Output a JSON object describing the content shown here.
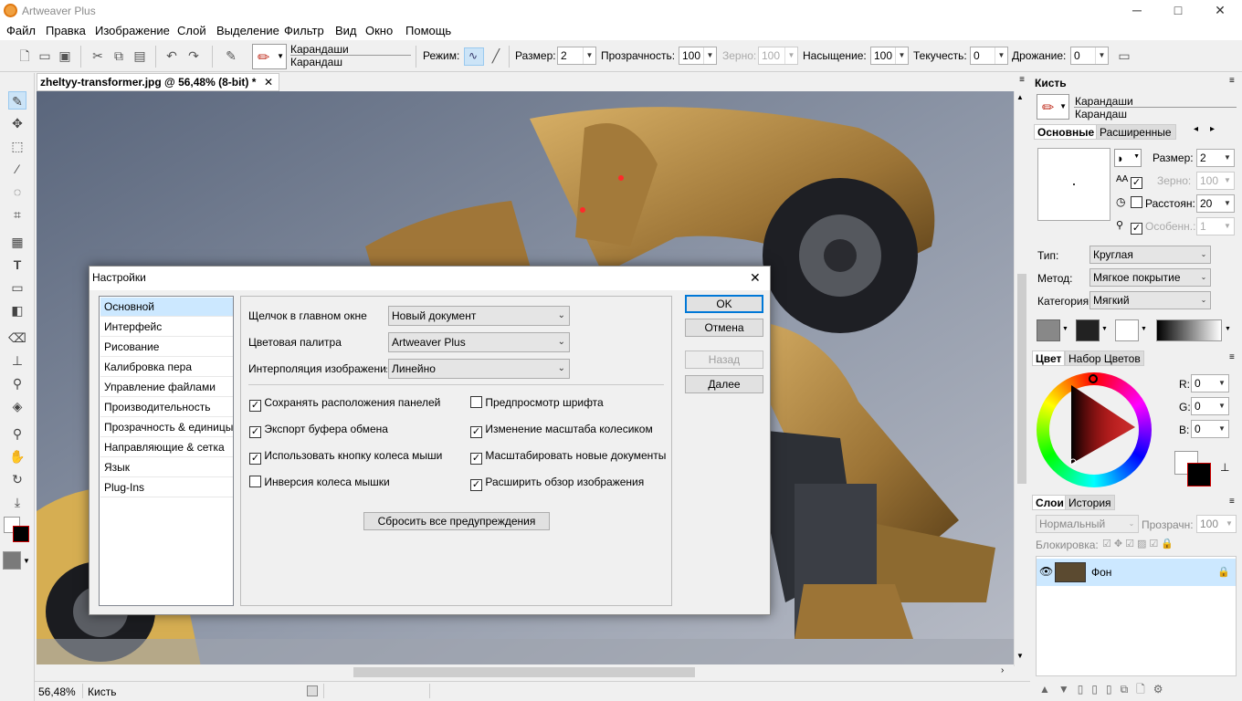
{
  "app": {
    "title": "Artweaver Plus",
    "min": "─",
    "max": "□",
    "close": "✕"
  },
  "menu": [
    "Файл",
    "Правка",
    "Изображение",
    "Слой",
    "Выделение",
    "Фильтр",
    "Вид",
    "Окно",
    "Помощь"
  ],
  "toolbar": {
    "brush_category": "Карандаши",
    "brush_name": "Карандаш",
    "mode_label": "Режим:",
    "size_label": "Размер:",
    "size_value": "2",
    "opacity_label": "Прозрачность:",
    "opacity_value": "100",
    "grain_label": "Зерно:",
    "grain_value": "100",
    "saturation_label": "Насыщение:",
    "saturation_value": "100",
    "flow_label": "Текучесть:",
    "flow_value": "0",
    "jitter_label": "Дрожание:",
    "jitter_value": "0"
  },
  "document": {
    "tab_title": "zheltyy-transformer.jpg @ 56,48% (8-bit) *",
    "close": "✕"
  },
  "status": {
    "zoom": "56,48%",
    "tool": "Кисть"
  },
  "brush_panel": {
    "title": "Кисть",
    "category": "Карандаши",
    "name": "Карандаш",
    "tabs": [
      "Основные",
      "Расширенные"
    ],
    "size_label": "Размер:",
    "size_value": "2",
    "grain_label": "Зерно:",
    "grain_value": "100",
    "spacing_label": "Расстоян:",
    "spacing_value": "20",
    "feature_label": "Особенн.:",
    "feature_value": "1",
    "type_label": "Тип:",
    "type_value": "Круглая",
    "method_label": "Метод:",
    "method_value": "Мягкое покрытие",
    "category_label": "Категория:",
    "category_value": "Мягкий"
  },
  "color_panel": {
    "tabs": [
      "Цвет",
      "Набор Цветов"
    ],
    "r_label": "R:",
    "r_value": "0",
    "g_label": "G:",
    "g_value": "0",
    "b_label": "B:",
    "b_value": "0",
    "foreground": "#000000",
    "background": "#ffffff"
  },
  "layers_panel": {
    "tabs": [
      "Слои",
      "История"
    ],
    "blend_mode": "Нормальный",
    "opacity_label": "Прозрачн:",
    "opacity_value": "100",
    "lock_label": "Блокировка:",
    "layer_name": "Фон"
  },
  "settings_dialog": {
    "title": "Настройки",
    "close": "✕",
    "categories": [
      "Основной",
      "Интерфейс",
      "Рисование",
      "Калибровка пера",
      "Управление файлами",
      "Производительность",
      "Прозрачность & единицы",
      "Направляющие & сетка",
      "Язык",
      "Plug-Ins"
    ],
    "selected_category": "Основной",
    "click_label": "Щелчок в главном окне",
    "click_value": "Новый документ",
    "palette_label": "Цветовая палитра",
    "palette_value": "Artweaver Plus",
    "interp_label": "Интерполяция изображения",
    "interp_value": "Линейно",
    "checkboxes_left": [
      {
        "label": "Сохранять расположения панелей",
        "checked": true
      },
      {
        "label": "Экспорт буфера обмена",
        "checked": true
      },
      {
        "label": "Использовать кнопку колеса мыши",
        "checked": true
      },
      {
        "label": "Инверсия колеса мышки",
        "checked": false
      }
    ],
    "checkboxes_right": [
      {
        "label": "Предпросмотр шрифта",
        "checked": false
      },
      {
        "label": "Изменение масштаба колесиком",
        "checked": true
      },
      {
        "label": "Масштабировать новые документы",
        "checked": true
      },
      {
        "label": "Расширить обзор изображения",
        "checked": true
      }
    ],
    "reset_button": "Сбросить все предупреждения",
    "ok": "OK",
    "cancel": "Отмена",
    "back": "Назад",
    "next": "Далее"
  }
}
